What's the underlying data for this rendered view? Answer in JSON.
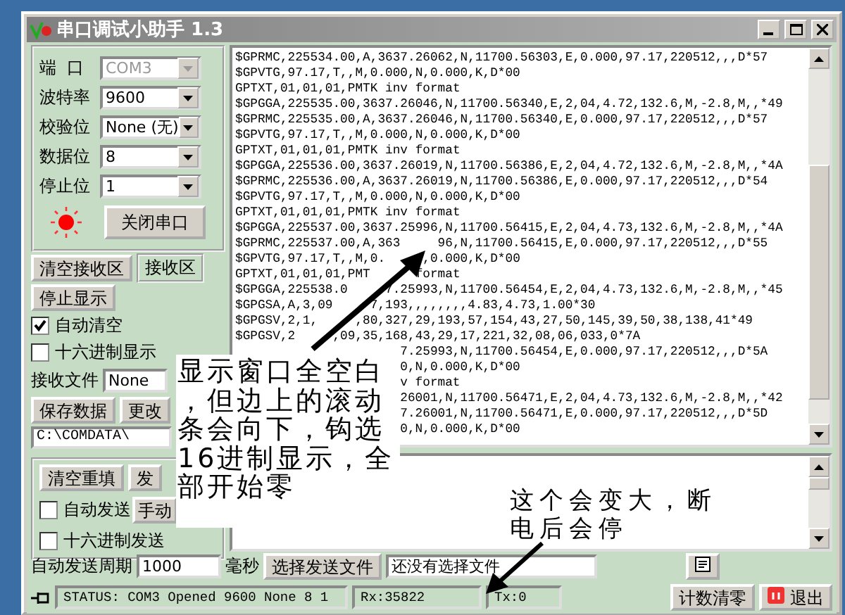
{
  "window": {
    "title": "串口调试小助手 1.3"
  },
  "port_settings": [
    {
      "label": "端  口",
      "value": "COM3",
      "disabled": true
    },
    {
      "label": "波特率",
      "value": "9600",
      "disabled": false
    },
    {
      "label": "校验位",
      "value": "None (无)",
      "disabled": false
    },
    {
      "label": "数据位",
      "value": "8",
      "disabled": false
    },
    {
      "label": "停止位",
      "value": "1",
      "disabled": false
    }
  ],
  "indicator": {
    "on": true
  },
  "port_button": "关闭串口",
  "receive": {
    "clear_button": "清空接收区",
    "area_label": "接收区",
    "pause_button": "停止显示",
    "options": [
      {
        "label": "自动清空",
        "checked": true
      },
      {
        "label": "十六进制显示",
        "checked": false
      }
    ],
    "file_label": "接收文件",
    "file_value": "None",
    "save_button": "保存数据",
    "change_button": "更改",
    "path": "C:\\COMDATA\\",
    "lines": [
      {
        "kind": "full",
        "text": "$GPRMC,225534.00,A,3637.26062,N,11700.56303,E,0.000,97.17,220512,,,D*57"
      },
      {
        "kind": "full",
        "text": "$GPVTG,97.17,T,,M,0.000,N,0.000,K,D*00"
      },
      {
        "kind": "full",
        "text": "GPTXT,01,01,01,PMTK inv format"
      },
      {
        "kind": "full",
        "text": "$GPGGA,225535.00,3637.26046,N,11700.56340,E,2,04,4.72,132.6,M,-2.8,M,,*49"
      },
      {
        "kind": "full",
        "text": "$GPRMC,225535.00,A,3637.26046,N,11700.56340,E,0.000,97.17,220512,,,D*57"
      },
      {
        "kind": "full",
        "text": "$GPVTG,97.17,T,,M,0.000,N,0.000,K,D*00"
      },
      {
        "kind": "full",
        "text": "GPTXT,01,01,01,PMTK inv format"
      },
      {
        "kind": "full",
        "text": "$GPGGA,225536.00,3637.26019,N,11700.56386,E,2,04,4.72,132.6,M,-2.8,M,,*4A"
      },
      {
        "kind": "full",
        "text": "$GPRMC,225536.00,A,3637.26019,N,11700.56386,E,0.000,97.17,220512,,,D*54"
      },
      {
        "kind": "full",
        "text": "$GPVTG,97.17,T,,M,0.000,N,0.000,K,D*00"
      },
      {
        "kind": "full",
        "text": "GPTXT,01,01,01,PMTK inv format"
      },
      {
        "kind": "full",
        "text": "$GPGGA,225537.00,3637.25996,N,11700.56415,E,2,04,4.73,132.6,M,-2.8,M,,*4A"
      },
      {
        "kind": "split",
        "parts": [
          "$GPRMC,225537.00,A,363",
          "96,N,11700.56415,E,0.000,97.17,220512,,,D*55"
        ]
      },
      {
        "kind": "split",
        "parts": [
          "$GPVTG,97.17,T,,M,0.",
          ",0.000,K,D*00"
        ]
      },
      {
        "kind": "split",
        "parts": [
          "GPTXT,01,01,01,PMT",
          " format"
        ]
      },
      {
        "kind": "split",
        "parts": [
          "$GPGGA,225538.0",
          "7.25993,N,11700.56454,E,2,04,4.73,132.6,M,-2.8,M,,*45"
        ]
      },
      {
        "kind": "split",
        "parts": [
          "$GPGSA,A,3,09",
          "7,193,,,,,,,,4.83,4.73,1.00*30"
        ]
      },
      {
        "kind": "split",
        "parts": [
          "$GPGSV,2,1,",
          ",80,327,29,193,57,154,43,27,50,145,39,50,38,138,41*49"
        ]
      },
      {
        "kind": "split",
        "parts": [
          "$GPGSV,2",
          ",09,35,168,43,29,17,221,32,08,06,033,0*7A"
        ]
      },
      {
        "kind": "tail",
        "text": "7.25993,N,11700.56454,E,0.000,97.17,220512,,,D*5A"
      },
      {
        "kind": "tail",
        "text": "0,N,0.000,K,D*00"
      },
      {
        "kind": "tail",
        "text": "v format"
      },
      {
        "kind": "tail",
        "text": "26001,N,11700.56471,E,2,04,4.73,132.6,M,-2.8,M,,*42"
      },
      {
        "kind": "tail",
        "text": "7.26001,N,11700.56471,E,0.000,97.17,220512,,,D*5D"
      },
      {
        "kind": "tail",
        "text": "0,N,0.000,K,D*00"
      }
    ]
  },
  "send": {
    "clear_button": "清空重填",
    "send_button": "发",
    "manual_button": "手动",
    "options": [
      {
        "label": "自动发送",
        "checked": false
      },
      {
        "label": "十六进制发送",
        "checked": false
      }
    ],
    "period_label": "自动发送周期",
    "period_value": "1000",
    "unit": "毫秒",
    "file_button": "选择发送文件",
    "file_status": "还没有选择文件"
  },
  "status_bar": {
    "status": "STATUS: COM3 Opened 9600 None  8 1",
    "rx": "Rx:35822",
    "tx": "Tx:0",
    "reset_button": "计数清零",
    "exit_button": "退出"
  },
  "annotations": [
    {
      "text": "显示窗口全空白，但边上的滚动条会向下，钩选16进制显示，全部开始零"
    },
    {
      "text": "这个会变大，断电后会停"
    }
  ]
}
